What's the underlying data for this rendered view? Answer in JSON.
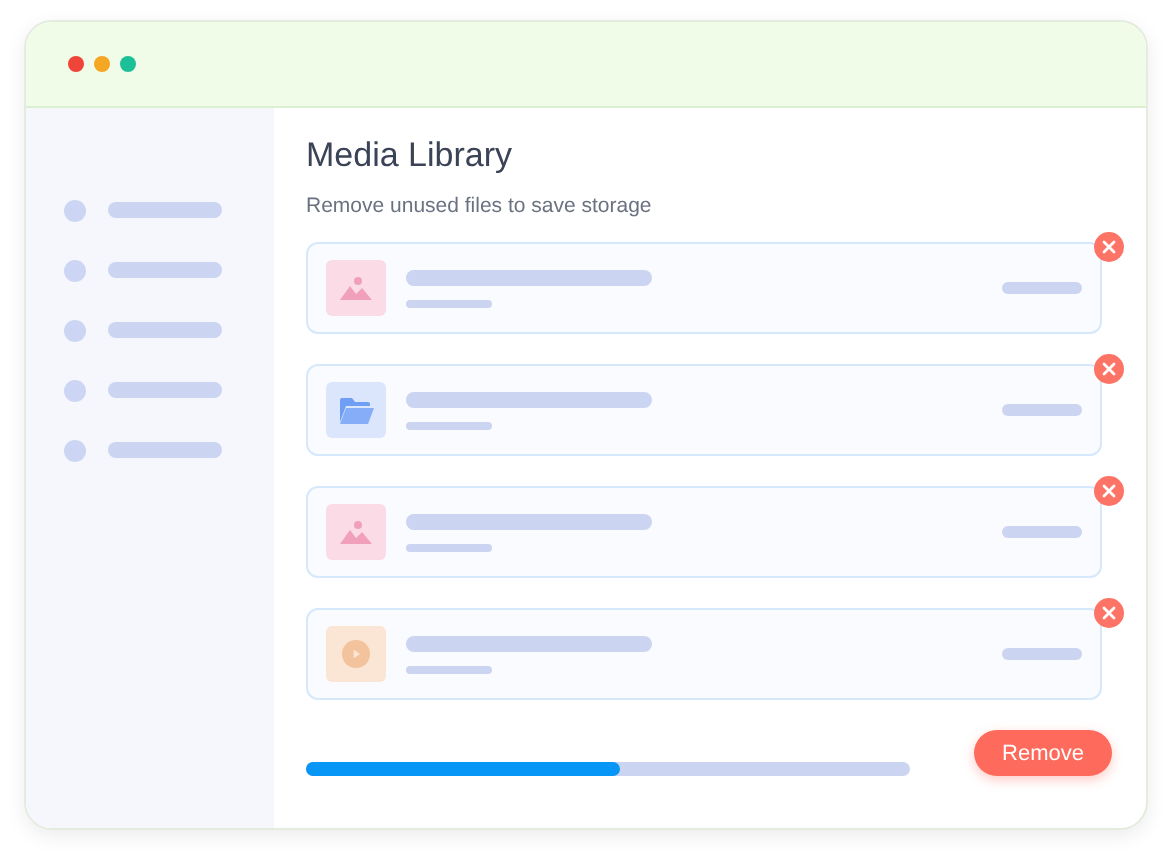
{
  "window": {
    "controls": [
      {
        "color": "#ef4438"
      },
      {
        "color": "#f5a623"
      },
      {
        "color": "#1dbf98"
      }
    ]
  },
  "sidebar": {
    "items": [
      {
        "kind": "placeholder"
      },
      {
        "kind": "placeholder"
      },
      {
        "kind": "placeholder"
      },
      {
        "kind": "placeholder"
      },
      {
        "kind": "placeholder"
      }
    ]
  },
  "title": "Media Library",
  "subtitle": "Remove unused files to save storage",
  "files": [
    {
      "kind": "image"
    },
    {
      "kind": "folder"
    },
    {
      "kind": "image"
    },
    {
      "kind": "video"
    }
  ],
  "progress": {
    "level": 0.52
  },
  "remove_button": "Remove"
}
